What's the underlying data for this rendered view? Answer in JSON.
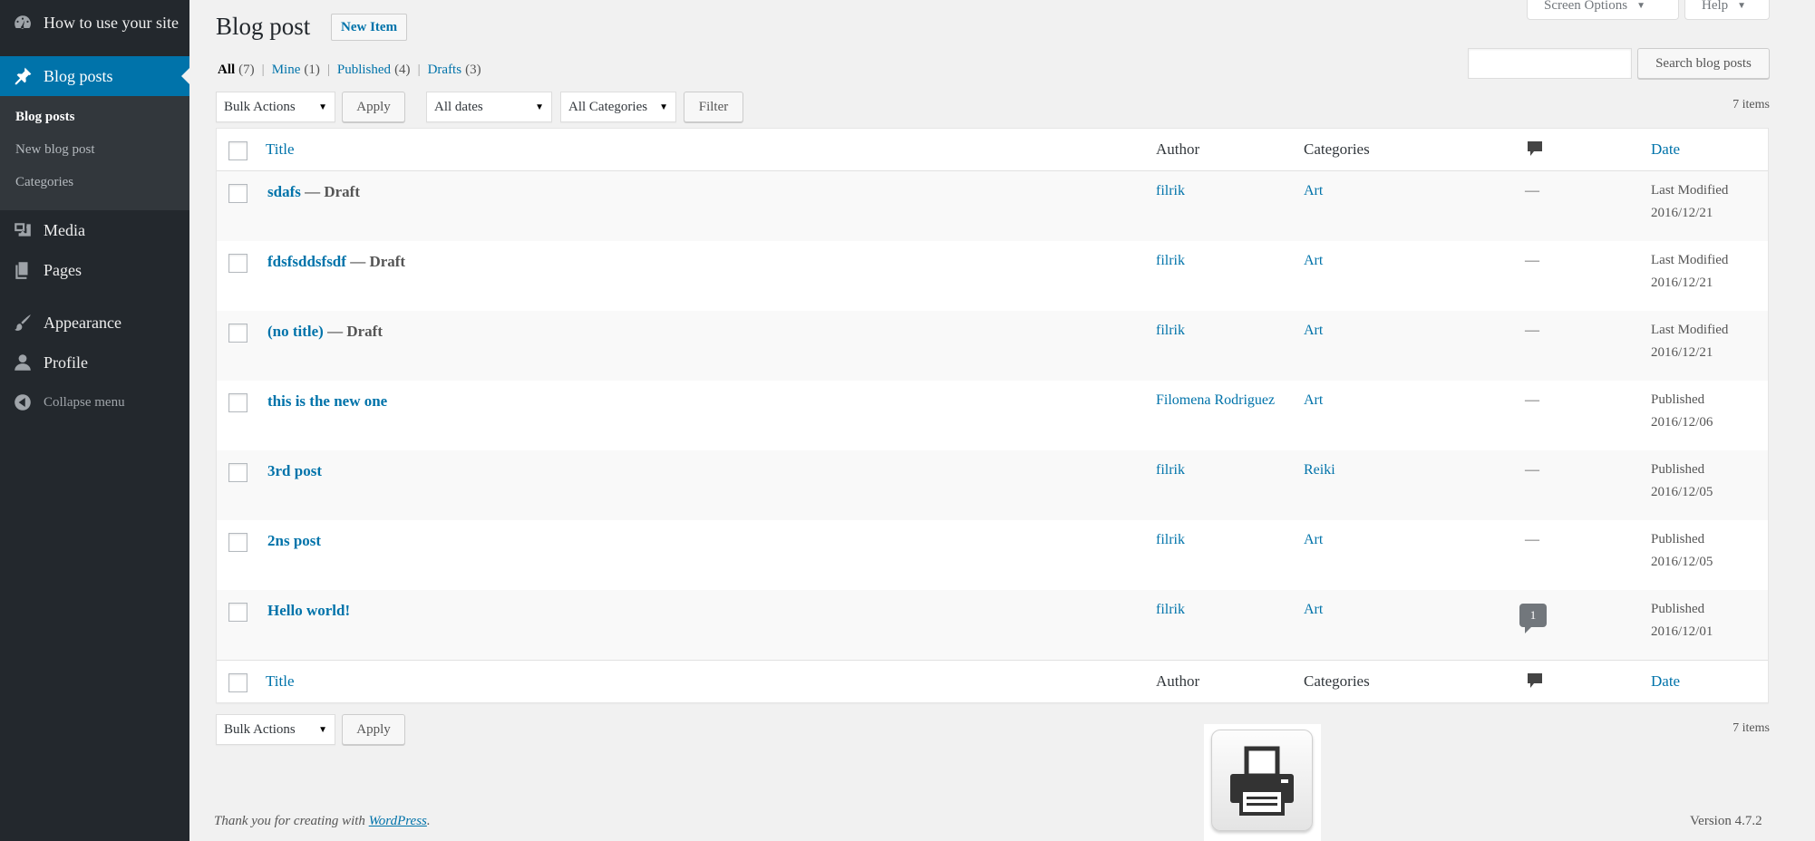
{
  "sidebar": {
    "dashboard_label": "How to use your site",
    "blog_posts_label": "Blog posts",
    "submenu": [
      "Blog posts",
      "New blog post",
      "Categories"
    ],
    "media_label": "Media",
    "pages_label": "Pages",
    "appearance_label": "Appearance",
    "profile_label": "Profile",
    "collapse_label": "Collapse menu"
  },
  "header": {
    "title": "Blog post",
    "new_item_label": "New Item",
    "screen_options_label": "Screen Options",
    "help_label": "Help"
  },
  "filters": {
    "views": [
      {
        "label": "All",
        "count": "(7)"
      },
      {
        "label": "Mine",
        "count": "(1)"
      },
      {
        "label": "Published",
        "count": "(4)"
      },
      {
        "label": "Drafts",
        "count": "(3)"
      }
    ],
    "search_value": "",
    "search_button_label": "Search blog posts",
    "bulk_actions": "Bulk Actions",
    "apply_label": "Apply",
    "dates": "All dates",
    "categories": "All Categories",
    "filter_label": "Filter",
    "items_count": "7 items"
  },
  "table": {
    "headers": {
      "title": "Title",
      "author": "Author",
      "categories": "Categories",
      "date": "Date"
    },
    "rows": [
      {
        "title": "sdafs",
        "state": "— Draft",
        "author": "filrik",
        "category": "Art",
        "comments": "—",
        "date_status": "Last Modified",
        "date": "2016/12/21"
      },
      {
        "title": "fdsfsddsfsdf",
        "state": "— Draft",
        "author": "filrik",
        "category": "Art",
        "comments": "—",
        "date_status": "Last Modified",
        "date": "2016/12/21"
      },
      {
        "title": "(no title)",
        "state": "— Draft",
        "author": "filrik",
        "category": "Art",
        "comments": "—",
        "date_status": "Last Modified",
        "date": "2016/12/21"
      },
      {
        "title": "this is the new one",
        "state": "",
        "author": "Filomena Rodriguez",
        "category": "Art",
        "comments": "—",
        "date_status": "Published",
        "date": "2016/12/06"
      },
      {
        "title": "3rd post",
        "state": "",
        "author": "filrik",
        "category": "Reiki",
        "comments": "—",
        "date_status": "Published",
        "date": "2016/12/05"
      },
      {
        "title": "2ns post",
        "state": "",
        "author": "filrik",
        "category": "Art",
        "comments": "—",
        "date_status": "Published",
        "date": "2016/12/05"
      },
      {
        "title": "Hello world!",
        "state": "",
        "author": "filrik",
        "category": "Art",
        "comments": "1",
        "date_status": "Published",
        "date": "2016/12/01"
      }
    ]
  },
  "footer": {
    "thanks_prefix": "Thank you for creating with ",
    "wordpress_link": "WordPress",
    "thanks_suffix": ".",
    "version": "Version 4.7.2"
  },
  "colors": {
    "sidebar_bg": "#23282d",
    "accent": "#0073aa",
    "page_bg": "#f1f1f1"
  }
}
